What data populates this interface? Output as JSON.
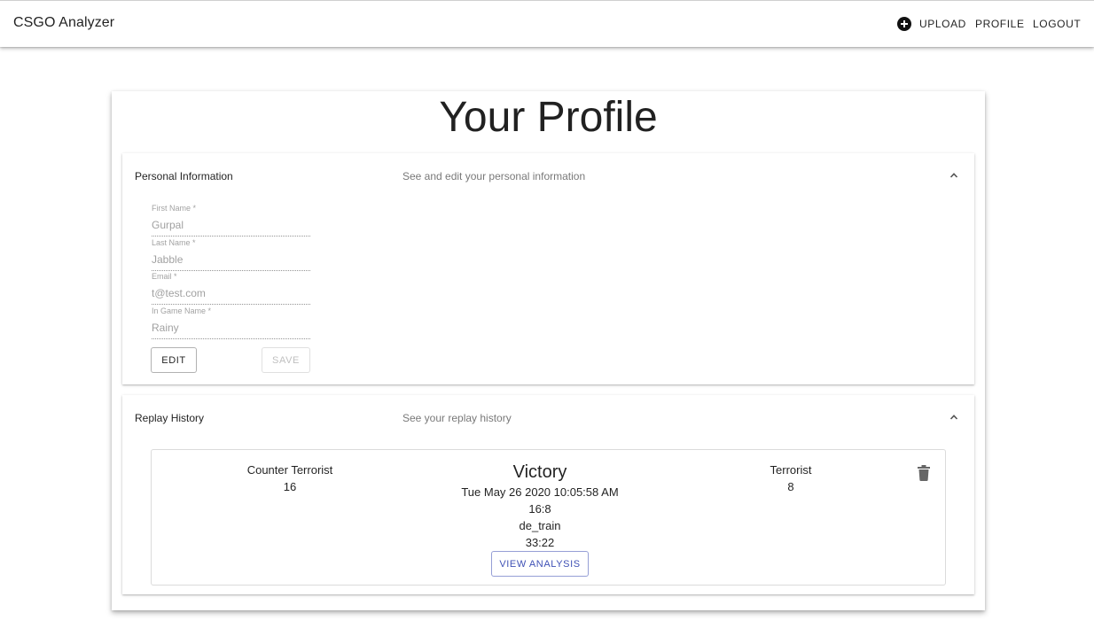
{
  "app": {
    "title": "CSGO Analyzer"
  },
  "nav": {
    "upload_label": "UPLOAD",
    "profile_label": "PROFILE",
    "logout_label": "LOGOUT"
  },
  "page": {
    "title": "Your Profile"
  },
  "personal": {
    "heading": "Personal Information",
    "subheading": "See and edit your personal information",
    "fields": [
      {
        "label": "First Name *",
        "value": "Gurpal"
      },
      {
        "label": "Last Name *",
        "value": "Jabble"
      },
      {
        "label": "Email *",
        "value": "t@test.com"
      },
      {
        "label": "In Game Name *",
        "value": "Rainy"
      }
    ],
    "edit_label": "EDIT",
    "save_label": "SAVE"
  },
  "replay": {
    "heading": "Replay History",
    "subheading": "See your replay history",
    "items": [
      {
        "left_team": "Counter Terrorist",
        "left_score": "16",
        "result": "Victory",
        "date": "Tue May 26 2020 10:05:58 AM",
        "score": "16:8",
        "map": "de_train",
        "duration": "33:22",
        "right_team": "Terrorist",
        "right_score": "8",
        "view_label": "VIEW ANALYSIS"
      }
    ]
  },
  "icons": {
    "upload": "add-circle-icon",
    "expand": "chevron-up-icon",
    "delete": "trash-icon"
  },
  "colors": {
    "accent": "#3f51b5"
  }
}
